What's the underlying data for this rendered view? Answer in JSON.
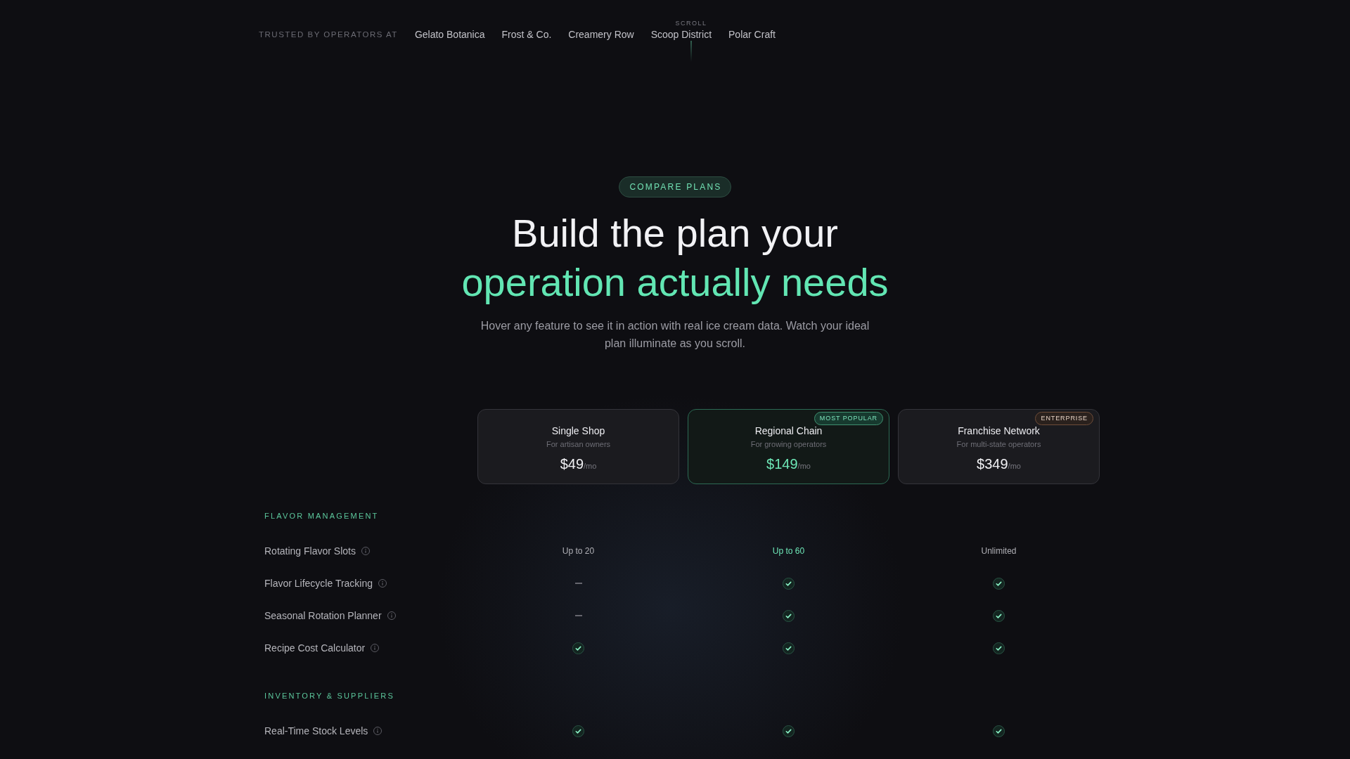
{
  "trusted_bar": {
    "label": "TRUSTED BY OPERATORS AT",
    "brands": [
      "Gelato Botanica",
      "Frost & Co.",
      "Creamery Row",
      "Scoop District",
      "Polar Craft"
    ]
  },
  "scroll_indicator": {
    "label": "SCROLL"
  },
  "hero": {
    "tag": "COMPARE PLANS",
    "title_line_1": "Build the plan your",
    "title_line_2": "operation actually needs",
    "subtitle": "Hover any feature to see it in action with real ice cream data. Watch your ideal plan illuminate as you scroll."
  },
  "plans": [
    {
      "name": "Single Shop",
      "description": "For artisan owners",
      "price": "$49",
      "period": "/mo",
      "highlighted": false
    },
    {
      "name": "Regional Chain",
      "description": "For growing operators",
      "price": "$149",
      "period": "/mo",
      "highlighted": true,
      "badge": {
        "label": "MOST POPULAR",
        "kind": "popular"
      }
    },
    {
      "name": "Franchise Network",
      "description": "For multi-state operators",
      "price": "$349",
      "period": "/mo",
      "highlighted": false,
      "badge": {
        "label": "ENTERPRISE",
        "kind": "enterprise"
      }
    }
  ],
  "sections": [
    {
      "title": "FLAVOR MANAGEMENT",
      "features": [
        {
          "name": "Rotating Flavor Slots",
          "cells": [
            {
              "kind": "text",
              "value": "Up to 20"
            },
            {
              "kind": "text",
              "value": "Up to 60"
            },
            {
              "kind": "text",
              "value": "Unlimited"
            }
          ]
        },
        {
          "name": "Flavor Lifecycle Tracking",
          "cells": [
            {
              "kind": "none"
            },
            {
              "kind": "check"
            },
            {
              "kind": "check"
            }
          ]
        },
        {
          "name": "Seasonal Rotation Planner",
          "cells": [
            {
              "kind": "none"
            },
            {
              "kind": "check"
            },
            {
              "kind": "check"
            }
          ]
        },
        {
          "name": "Recipe Cost Calculator",
          "cells": [
            {
              "kind": "check"
            },
            {
              "kind": "check"
            },
            {
              "kind": "check"
            }
          ]
        }
      ]
    },
    {
      "title": "INVENTORY & SUPPLIERS",
      "features": [
        {
          "name": "Real-Time Stock Levels",
          "cells": [
            {
              "kind": "check"
            },
            {
              "kind": "check"
            },
            {
              "kind": "check"
            }
          ]
        }
      ]
    }
  ]
}
